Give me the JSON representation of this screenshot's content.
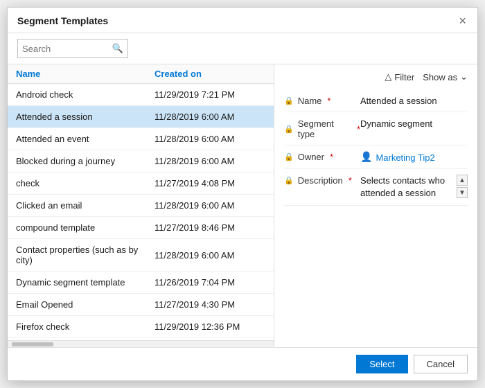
{
  "dialog": {
    "title": "Segment Templates",
    "close_label": "×"
  },
  "search": {
    "placeholder": "Search",
    "value": ""
  },
  "list": {
    "col_name": "Name",
    "col_created": "Created on",
    "rows": [
      {
        "name": "Android check",
        "created": "11/29/2019 7:21 PM",
        "selected": false
      },
      {
        "name": "Attended a session",
        "created": "11/28/2019 6:00 AM",
        "selected": true
      },
      {
        "name": "Attended an event",
        "created": "11/28/2019 6:00 AM",
        "selected": false
      },
      {
        "name": "Blocked during a journey",
        "created": "11/28/2019 6:00 AM",
        "selected": false
      },
      {
        "name": "check",
        "created": "11/27/2019 4:08 PM",
        "selected": false
      },
      {
        "name": "Clicked an email",
        "created": "11/28/2019 6:00 AM",
        "selected": false
      },
      {
        "name": "compound template",
        "created": "11/27/2019 8:46 PM",
        "selected": false
      },
      {
        "name": "Contact properties (such as by city)",
        "created": "11/28/2019 6:00 AM",
        "selected": false
      },
      {
        "name": "Dynamic segment template",
        "created": "11/26/2019 7:04 PM",
        "selected": false
      },
      {
        "name": "Email Opened",
        "created": "11/27/2019 4:30 PM",
        "selected": false
      },
      {
        "name": "Firefox check",
        "created": "11/29/2019 12:36 PM",
        "selected": false
      }
    ]
  },
  "detail": {
    "filter_label": "Filter",
    "show_as_label": "Show as",
    "fields": [
      {
        "label": "Name",
        "required": true,
        "value": "Attended a session",
        "type": "text"
      },
      {
        "label": "Segment type",
        "required": true,
        "value": "Dynamic segment",
        "type": "text"
      },
      {
        "label": "Owner",
        "required": true,
        "value": "Marketing Tip2",
        "type": "link"
      },
      {
        "label": "Description",
        "required": true,
        "value": "Selects contacts who attended a session",
        "type": "description"
      }
    ]
  },
  "footer": {
    "select_label": "Select",
    "cancel_label": "Cancel"
  },
  "icons": {
    "search": "🔍",
    "close": "✕",
    "filter": "▽",
    "chevron_down": "∨",
    "lock": "🔒",
    "person": "👤",
    "arrow_up": "▲",
    "arrow_down": "▼"
  }
}
